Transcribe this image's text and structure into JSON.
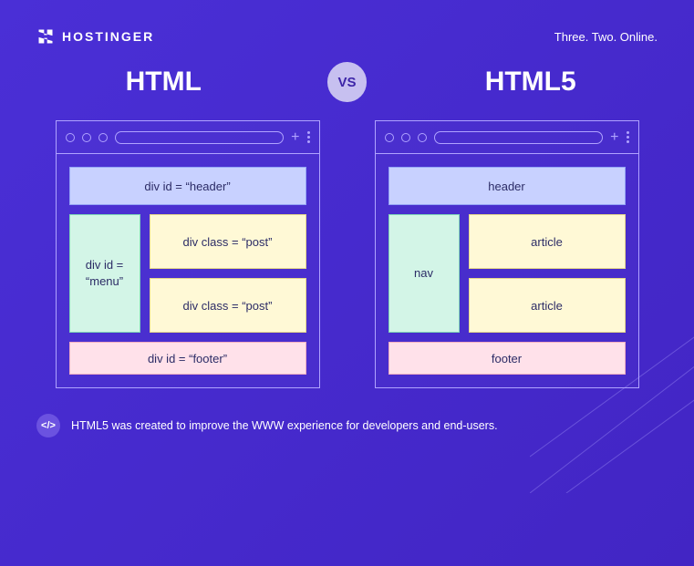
{
  "brand": {
    "name": "HOSTINGER",
    "tagline": "Three. Two. Online."
  },
  "titles": {
    "left": "HTML",
    "vs": "VS",
    "right": "HTML5"
  },
  "left": {
    "header": "div id = “header”",
    "menu": "div id = “menu”",
    "post1": "div class = “post”",
    "post2": "div class = “post”",
    "footer": "div id = “footer”"
  },
  "right": {
    "header": "header",
    "menu": "nav",
    "post1": "article",
    "post2": "article",
    "footer": "footer"
  },
  "footnote": {
    "badge": "</>",
    "text": "HTML5 was created to improve the WWW experience for developers and end-users."
  }
}
